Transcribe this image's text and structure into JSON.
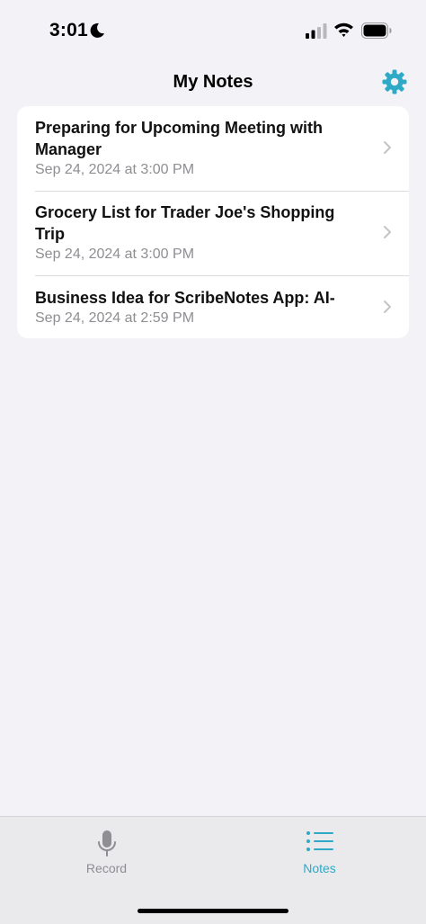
{
  "status_bar": {
    "time": "3:01",
    "icons": [
      "moon-icon",
      "signal-icon",
      "wifi-icon",
      "battery-icon"
    ]
  },
  "header": {
    "title": "My Notes",
    "settings_icon": "gear-icon"
  },
  "notes": [
    {
      "title": "Preparing for Upcoming Meeting with Manager",
      "date": "Sep 24, 2024 at 3:00 PM"
    },
    {
      "title": "Grocery List for Trader Joe's Shopping Trip",
      "date": "Sep 24, 2024 at 3:00 PM"
    },
    {
      "title": "Business Idea for ScribeNotes App: AI-",
      "date": "Sep 24, 2024 at 2:59 PM"
    }
  ],
  "tab_bar": {
    "tabs": [
      {
        "label": "Record",
        "icon": "microphone-icon",
        "selected": false
      },
      {
        "label": "Notes",
        "icon": "list-icon",
        "selected": true
      }
    ]
  },
  "colors": {
    "accent": "#2eaac6",
    "background": "#f2f2f7",
    "secondary_text": "#8e8e93",
    "tab_bar": "#eaeaec"
  }
}
